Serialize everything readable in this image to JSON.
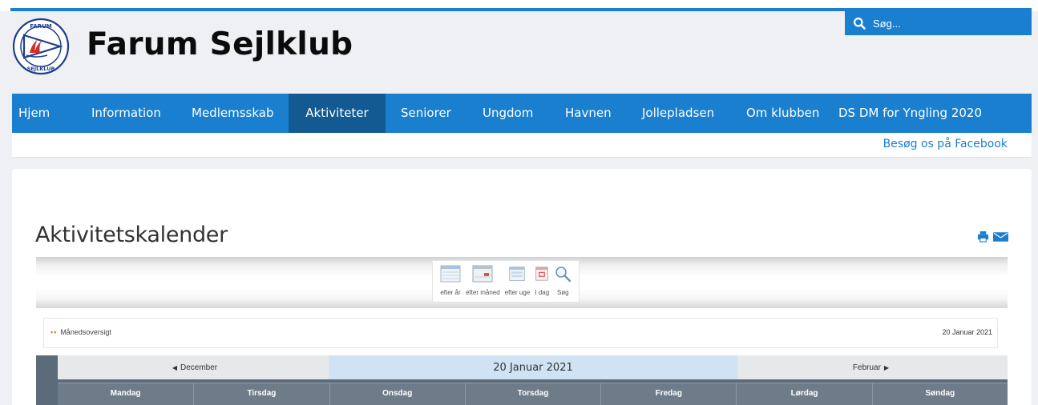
{
  "site": {
    "title": "Farum Sejlklub",
    "logo_text_top": "FARUM",
    "logo_text_bottom": "SEJLKLUB"
  },
  "search": {
    "placeholder": "Søg..."
  },
  "nav": {
    "items": [
      {
        "label": "Hjem"
      },
      {
        "label": "Information"
      },
      {
        "label": "Medlemsskab"
      },
      {
        "label": "Aktiviteter",
        "active": true
      },
      {
        "label": "Seniorer"
      },
      {
        "label": "Ungdom"
      },
      {
        "label": "Havnen"
      },
      {
        "label": "Jollepladsen"
      },
      {
        "label": "Om klubben"
      },
      {
        "label": "DS DM for Yngling 2020"
      }
    ]
  },
  "facebook": {
    "label": "Besøg os på Facebook"
  },
  "page": {
    "heading": "Aktivitetskalender"
  },
  "toolbar": {
    "by_year": "efter år",
    "by_month": "efter måned",
    "by_week": "efter uge",
    "today": "I dag",
    "search": "Søg"
  },
  "month_bar": {
    "overview_label": "Månedsoversigt",
    "date": "20 Januar 2021"
  },
  "calendar": {
    "prev": "December",
    "current": "20 Januar 2021",
    "next": "Februar",
    "days": [
      "Mandag",
      "Tirsdag",
      "Onsdag",
      "Torsdag",
      "Fredag",
      "Lørdag",
      "Søndag"
    ]
  },
  "colors": {
    "brand_blue": "#1a7fcf",
    "nav_active": "#125a91",
    "calendar_header": "#6e7c89",
    "current_month_bg": "#cfe3f4",
    "logo_red": "#d62b2b"
  }
}
